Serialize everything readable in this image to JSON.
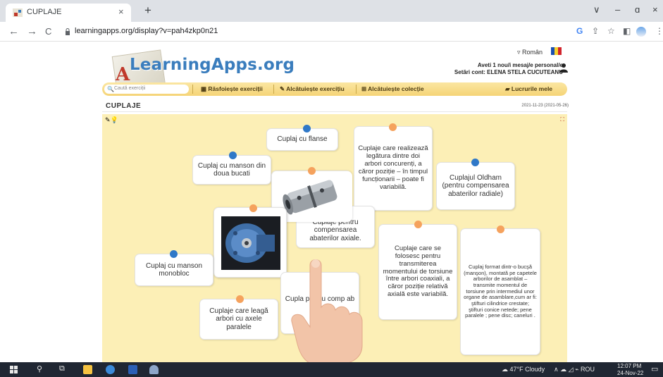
{
  "browser": {
    "tab_title": "CUPLAJE",
    "tab_close": "×",
    "new_tab": "+",
    "url": "learningapps.org/display?v=pah4zkp0n21",
    "nav": {
      "back": "←",
      "forward": "→",
      "reload": "C"
    },
    "window": {
      "chevron": "∨",
      "minimize": "–",
      "restore": "ɑ",
      "close": "×"
    },
    "toolbar_icons": {
      "google": "G",
      "share": "⇪",
      "star": "☆",
      "sidebar": "◧",
      "more": "⋮"
    }
  },
  "site": {
    "logo_text": "LearningApps.org",
    "logo_letter": "A",
    "language": "Român",
    "messages": "Aveti 1 nou/i mesaj/e personal/e",
    "account": "Setări cont: ELENA STELA CUCUTEANU",
    "search_placeholder": "Caută exerciții",
    "nav": {
      "browse": "Răsfoiește exerciții",
      "create_exercise": "Alcătuiește exercițiu",
      "create_collection": "Alcătuiește colecție",
      "my_work": "Lucrurile mele"
    },
    "nav_icons": {
      "browse": "▦",
      "create_exercise": "✎",
      "create_collection": "⊞",
      "my_work": "▰"
    },
    "flag_colors": [
      "#1b4fb0",
      "#f6d12c",
      "#d1242d"
    ]
  },
  "exercise": {
    "title": "CUPLAJE",
    "date": "2021-11-23 (2021-05-26)",
    "tools_icons": "✎💡",
    "expand": "⛶",
    "cards": [
      {
        "text": "Cuplaj cu flanse",
        "pin": "blue"
      },
      {
        "text": "Cuplaje care realizează legătura dintre doi arbori concurenți, a căror poziție – în timpul funcționarii – poate fi variabilă.",
        "pin": "orange"
      },
      {
        "text": "Cuplaj cu manson din doua bucati",
        "pin": "blue"
      },
      {
        "text": "Cuplajul Oldham (pentru compensarea abaterilor radiale)",
        "pin": "blue"
      },
      {
        "text": "Cuplaje pentru compensarea abaterilor axiale.",
        "pin": "orange"
      },
      {
        "text": "Cuplaje care se folosesc pentru transmiterea momentului de torsiune între arbori coaxiali, a căror poziție relativă axială este variabilă.",
        "pin": "orange"
      },
      {
        "text": "Cuplaj format dintr-o bucşă (manşon), montată pe capetele arborilor de asamblat – transmite momentul de torsiune prin intermediul unor organe de asamblare,cum ar fi: ştifturi cilindrice crestate; ştifturi conice netede; pene paralele ; pene disc; caneluri .",
        "pin": "orange"
      },
      {
        "text": "Cuplaj cu manson monobloc",
        "pin": "blue"
      },
      {
        "text": "Cupla pentru comp ab u",
        "pin": "orange"
      },
      {
        "text": "Cuplaje care leagă arbori cu axele paralele",
        "pin": "orange"
      }
    ]
  },
  "taskbar": {
    "weather": "47°F  Cloudy",
    "tray": "ROU",
    "time": "12:07 PM",
    "date": "24-Nov-22"
  }
}
